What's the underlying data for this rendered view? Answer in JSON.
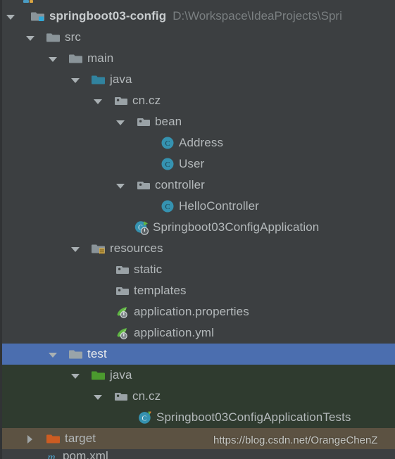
{
  "window": {
    "title": "Project tool window",
    "background_color": "#3c3f41",
    "selection_color": "#4b6eaf",
    "test_scope_color": "#2f3b2f",
    "excluded_color": "#5c5242"
  },
  "watermark": {
    "text": "https://blog.csdn.net/OrangeChenZ"
  },
  "tree": {
    "rows": [
      {
        "id": "row-partial-top",
        "label": "",
        "secondary": "",
        "icon": "module-icon",
        "indent": 0,
        "arrow": "none",
        "scope": "default",
        "partial": "top"
      },
      {
        "id": "row-springboot03-config",
        "label": "springboot03-config",
        "secondary": "D:\\Workspace\\IdeaProjects\\Spri",
        "icon": "project-module-icon",
        "indent": 0,
        "arrow": "down",
        "scope": "default",
        "bold": true
      },
      {
        "id": "row-src",
        "label": "src",
        "secondary": "",
        "icon": "folder-gray-icon",
        "indent": 1,
        "arrow": "down",
        "scope": "default"
      },
      {
        "id": "row-main",
        "label": "main",
        "secondary": "",
        "icon": "folder-gray-icon",
        "indent": 2,
        "arrow": "down",
        "scope": "default"
      },
      {
        "id": "row-java-main",
        "label": "java",
        "secondary": "",
        "icon": "folder-source-blue-icon",
        "indent": 3,
        "arrow": "down",
        "scope": "default"
      },
      {
        "id": "row-cn-cz-main",
        "label": "cn.cz",
        "secondary": "",
        "icon": "package-icon",
        "indent": 4,
        "arrow": "down",
        "scope": "default"
      },
      {
        "id": "row-bean",
        "label": "bean",
        "secondary": "",
        "icon": "package-icon",
        "indent": 5,
        "arrow": "down",
        "scope": "default"
      },
      {
        "id": "row-address",
        "label": "Address",
        "secondary": "",
        "icon": "java-class-icon",
        "indent": 6,
        "arrow": "none",
        "scope": "default"
      },
      {
        "id": "row-user",
        "label": "User",
        "secondary": "",
        "icon": "java-class-icon",
        "indent": 6,
        "arrow": "none",
        "scope": "default"
      },
      {
        "id": "row-controller",
        "label": "controller",
        "secondary": "",
        "icon": "package-icon",
        "indent": 5,
        "arrow": "down",
        "scope": "default"
      },
      {
        "id": "row-hellocontroller",
        "label": "HelloController",
        "secondary": "",
        "icon": "java-class-icon",
        "indent": 6,
        "arrow": "none",
        "scope": "default"
      },
      {
        "id": "row-springboot03configapplication",
        "label": "Springboot03ConfigApplication",
        "secondary": "",
        "icon": "spring-boot-run-class-icon",
        "indent": 5,
        "arrow": "none",
        "scope": "default"
      },
      {
        "id": "row-resources",
        "label": "resources",
        "secondary": "",
        "icon": "folder-resources-icon",
        "indent": 3,
        "arrow": "down",
        "scope": "default"
      },
      {
        "id": "row-static",
        "label": "static",
        "secondary": "",
        "icon": "package-icon",
        "indent": 4,
        "arrow": "none",
        "scope": "default"
      },
      {
        "id": "row-templates",
        "label": "templates",
        "secondary": "",
        "icon": "package-icon",
        "indent": 4,
        "arrow": "none",
        "scope": "default"
      },
      {
        "id": "row-application-properties",
        "label": "application.properties",
        "secondary": "",
        "icon": "spring-config-file-icon",
        "indent": 4,
        "arrow": "none",
        "scope": "default"
      },
      {
        "id": "row-application-yml",
        "label": "application.yml",
        "secondary": "",
        "icon": "spring-config-file-icon",
        "indent": 4,
        "arrow": "none",
        "scope": "default"
      },
      {
        "id": "row-test",
        "label": "test",
        "secondary": "",
        "icon": "folder-gray-icon",
        "indent": 2,
        "arrow": "down",
        "scope": "selected"
      },
      {
        "id": "row-java-test",
        "label": "java",
        "secondary": "",
        "icon": "folder-test-green-icon",
        "indent": 3,
        "arrow": "down",
        "scope": "testscope"
      },
      {
        "id": "row-cn-cz-test",
        "label": "cn.cz",
        "secondary": "",
        "icon": "package-icon",
        "indent": 4,
        "arrow": "down",
        "scope": "testscope"
      },
      {
        "id": "row-springboot03configapplicationtests",
        "label": "Springboot03ConfigApplicationTests",
        "secondary": "",
        "icon": "java-test-class-icon",
        "indent": 5,
        "arrow": "none",
        "scope": "testscope"
      },
      {
        "id": "row-target",
        "label": "target",
        "secondary": "",
        "icon": "folder-excluded-orange-icon",
        "indent": 1,
        "arrow": "right",
        "scope": "excluded"
      },
      {
        "id": "row-pom-xml",
        "label": "pom.xml",
        "secondary": "",
        "icon": "maven-icon",
        "indent": 1,
        "arrow": "none",
        "scope": "default",
        "partial": "bottom"
      }
    ]
  }
}
